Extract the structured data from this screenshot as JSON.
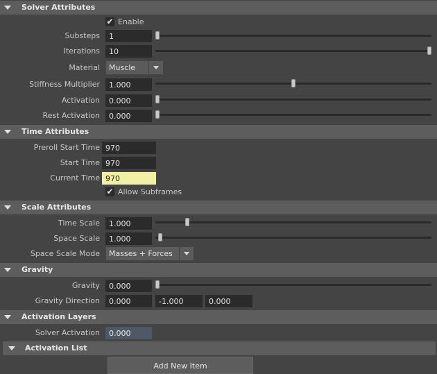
{
  "sections": {
    "solver": "Solver Attributes",
    "time": "Time Attributes",
    "scale": "Scale Attributes",
    "gravity": "Gravity",
    "layers": "Activation Layers",
    "list": "Activation List"
  },
  "solver": {
    "enable_label": "Enable",
    "enable_checked": true,
    "substeps_label": "Substeps",
    "substeps_value": "1",
    "iterations_label": "Iterations",
    "iterations_value": "10",
    "material_label": "Material",
    "material_value": "Muscle",
    "stiffness_label": "Stiffness Multiplier",
    "stiffness_value": "1.000",
    "activation_label": "Activation",
    "activation_value": "0.000",
    "rest_label": "Rest Activation",
    "rest_value": "0.000",
    "substeps_slider": 0.0,
    "iterations_slider": 1.0,
    "stiffness_slider": 0.5,
    "activation_slider": 0.0,
    "rest_slider": 0.0
  },
  "time": {
    "preroll_label": "Preroll Start Time",
    "preroll_value": "970",
    "start_label": "Start Time",
    "start_value": "970",
    "current_label": "Current Time",
    "current_value": "970",
    "subframes_label": "Allow Subframes",
    "subframes_checked": true
  },
  "scale": {
    "time_scale_label": "Time Scale",
    "time_scale_value": "1.000",
    "space_scale_label": "Space Scale",
    "space_scale_value": "1.000",
    "mode_label": "Space Scale Mode",
    "mode_value": "Masses + Forces",
    "time_scale_slider": 0.11,
    "space_scale_slider": 0.01
  },
  "gravity": {
    "gravity_label": "Gravity",
    "gravity_value": "0.000",
    "direction_label": "Gravity Direction",
    "dir_x": "0.000",
    "dir_y": "-1.000",
    "dir_z": "0.000",
    "gravity_slider": 0.0
  },
  "layers": {
    "solver_activation_label": "Solver Activation",
    "solver_activation_value": "0.000"
  },
  "list": {
    "add_button": "Add New Item"
  },
  "icons": {
    "collapse": "triangle-down-icon",
    "dropdown": "chevron-down-icon",
    "check": "checkmark-icon"
  }
}
